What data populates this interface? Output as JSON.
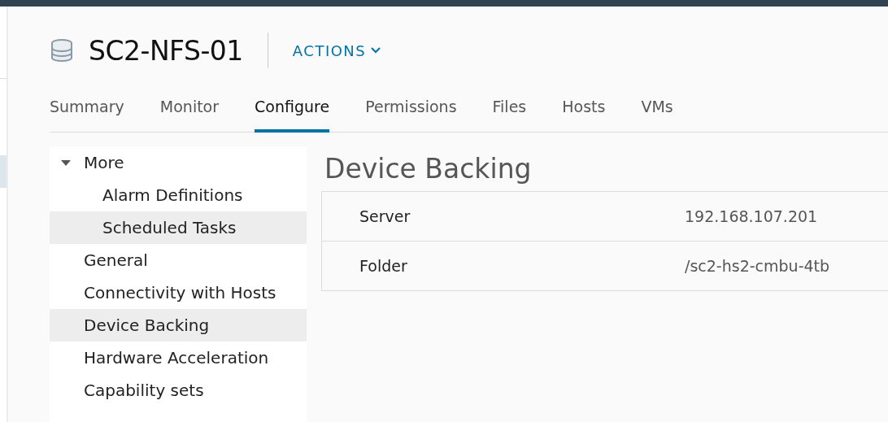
{
  "header": {
    "title": "SC2-NFS-01",
    "actions_label": "ACTIONS"
  },
  "tabs": [
    {
      "label": "Summary",
      "selected": false
    },
    {
      "label": "Monitor",
      "selected": false
    },
    {
      "label": "Configure",
      "selected": true
    },
    {
      "label": "Permissions",
      "selected": false
    },
    {
      "label": "Files",
      "selected": false
    },
    {
      "label": "Hosts",
      "selected": false
    },
    {
      "label": "VMs",
      "selected": false
    }
  ],
  "sidebar": {
    "items": [
      {
        "label": "More",
        "expanded": true,
        "selected": false,
        "children": [
          {
            "label": "Alarm Definitions",
            "selected": false
          },
          {
            "label": "Scheduled Tasks",
            "selected": true
          }
        ]
      },
      {
        "label": "General",
        "selected": false
      },
      {
        "label": "Connectivity with Hosts",
        "selected": false
      },
      {
        "label": "Device Backing",
        "selected": true
      },
      {
        "label": "Hardware Acceleration",
        "selected": false
      },
      {
        "label": "Capability sets",
        "selected": false
      }
    ]
  },
  "content": {
    "heading": "Device Backing",
    "rows": [
      {
        "label": "Server",
        "value": "192.168.107.201"
      },
      {
        "label": "Folder",
        "value": "/sc2-hs2-cmbu-4tb"
      }
    ]
  }
}
